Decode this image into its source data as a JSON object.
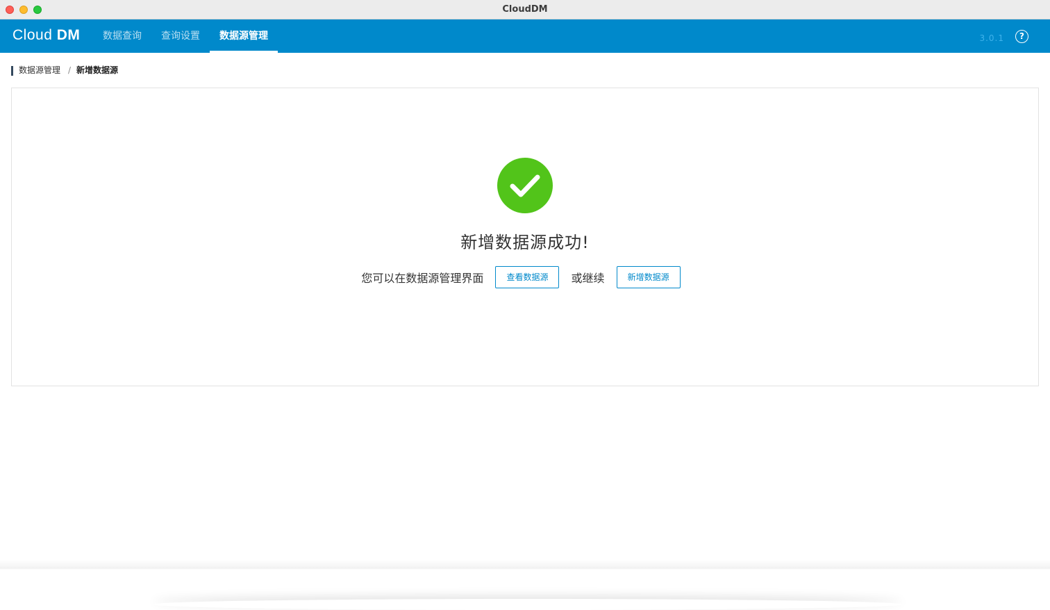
{
  "window": {
    "title": "CloudDM"
  },
  "nav": {
    "logo_cloud": "Cloud",
    "logo_dm": "DM",
    "items": [
      {
        "label": "数据查询"
      },
      {
        "label": "查询设置"
      },
      {
        "label": "数据源管理",
        "active": true
      }
    ],
    "version": "3.0.1",
    "help_glyph": "?"
  },
  "breadcrumb": {
    "parent": "数据源管理",
    "separator": "/",
    "current": "新增数据源"
  },
  "result": {
    "icon": "check-circle-icon",
    "icon_color": "#52c41a",
    "title": "新增数据源成功!",
    "message_prefix": "您可以在数据源管理界面",
    "view_button": "查看数据源",
    "message_middle": "或继续",
    "add_button": "新增数据源"
  },
  "colors": {
    "primary": "#0089cb"
  }
}
